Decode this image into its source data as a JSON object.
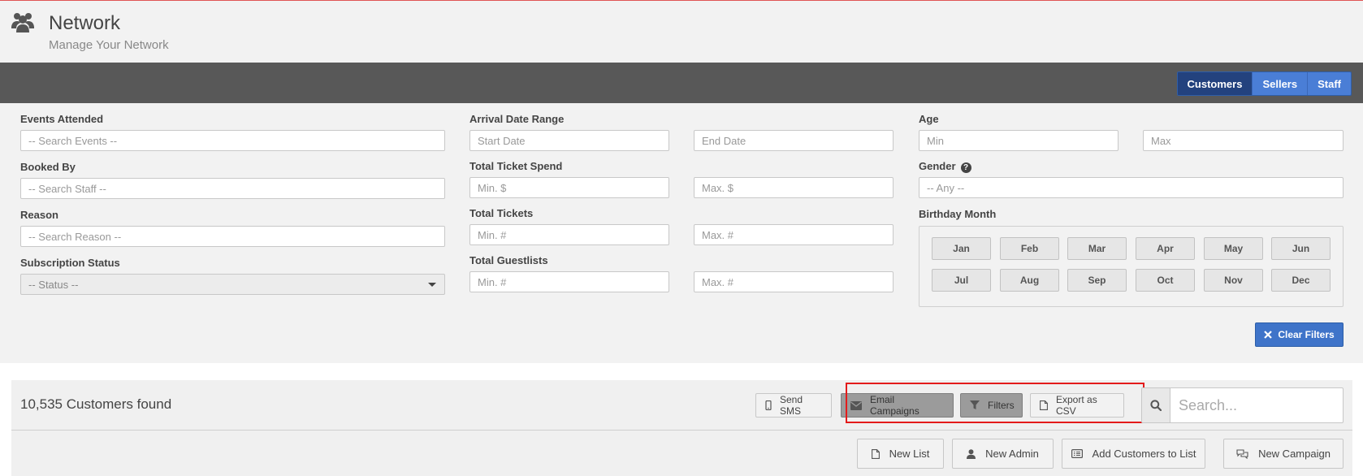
{
  "header": {
    "title": "Network",
    "subtitle": "Manage Your Network",
    "icon": "users-icon"
  },
  "tabs": [
    {
      "label": "Customers",
      "active": true
    },
    {
      "label": "Sellers",
      "active": false
    },
    {
      "label": "Staff",
      "active": false
    }
  ],
  "filters": {
    "events_attended": {
      "label": "Events Attended",
      "placeholder": "-- Search Events --"
    },
    "booked_by": {
      "label": "Booked By",
      "placeholder": "-- Search Staff --"
    },
    "reason": {
      "label": "Reason",
      "placeholder": "-- Search Reason --"
    },
    "subscription_status": {
      "label": "Subscription Status",
      "value": "-- Status --"
    },
    "arrival_date_range": {
      "label": "Arrival Date Range",
      "start_placeholder": "Start Date",
      "end_placeholder": "End Date"
    },
    "total_ticket_spend": {
      "label": "Total Ticket Spend",
      "min_placeholder": "Min. $",
      "max_placeholder": "Max. $"
    },
    "total_tickets": {
      "label": "Total Tickets",
      "min_placeholder": "Min. #",
      "max_placeholder": "Max. #"
    },
    "total_guestlists": {
      "label": "Total Guestlists",
      "min_placeholder": "Min. #",
      "max_placeholder": "Max. #"
    },
    "age": {
      "label": "Age",
      "min_placeholder": "Min",
      "max_placeholder": "Max"
    },
    "gender": {
      "label": "Gender",
      "value": "-- Any --"
    },
    "birthday_month": {
      "label": "Birthday Month",
      "months": [
        "Jan",
        "Feb",
        "Mar",
        "Apr",
        "May",
        "Jun",
        "Jul",
        "Aug",
        "Sep",
        "Oct",
        "Nov",
        "Dec"
      ]
    },
    "clear_label": "Clear Filters"
  },
  "results": {
    "count_text": "10,535 Customers found",
    "actions": {
      "send_sms": "Send SMS",
      "email_campaigns": "Email Campaigns",
      "filters": "Filters",
      "export_csv": "Export as CSV"
    },
    "search_placeholder": "Search...",
    "bottom_actions": {
      "new_list": "New List",
      "new_admin": "New Admin",
      "add_customers": "Add Customers to List",
      "new_campaign": "New Campaign"
    }
  },
  "colors": {
    "accent": "#4a7ed6",
    "tab_active": "#23427e",
    "header_bar": "#585858",
    "highlight": "#e31b1b"
  }
}
